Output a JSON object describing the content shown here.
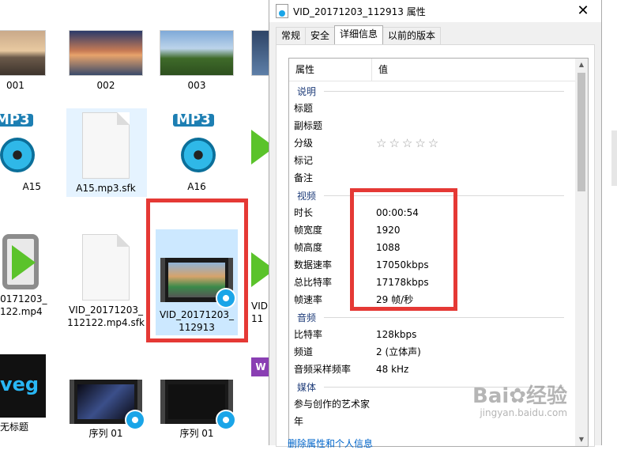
{
  "explorer": {
    "files": [
      {
        "label": "001",
        "icon": "photo-thumbnail"
      },
      {
        "label": "002",
        "icon": "photo-thumbnail"
      },
      {
        "label": "003",
        "icon": "photo-thumbnail"
      },
      {
        "label": "A15",
        "icon": "mp3-file-icon"
      },
      {
        "label": "A15.mp3.sfk",
        "icon": "blank-file-icon"
      },
      {
        "label": "A16",
        "icon": "mp3-file-icon"
      },
      {
        "label": "_20171203_\n2122.mp4",
        "icon": "video-player-icon"
      },
      {
        "label": "VID_20171203_\n112122.mp4.sfk",
        "icon": "blank-file-icon"
      },
      {
        "label": "VID_20171203_\n112913",
        "icon": "video-thumbnail"
      },
      {
        "label": "VID\n11",
        "icon": "video-player-icon"
      },
      {
        "label": "无标题",
        "icon": "vegas-project-icon"
      },
      {
        "label": "序列 01",
        "icon": "video-thumbnail"
      },
      {
        "label": "序列 01",
        "icon": "video-thumbnail"
      }
    ]
  },
  "dialog": {
    "title": "VID_20171203_112913 属性",
    "close_glyph": "✕",
    "tabs": [
      "常规",
      "安全",
      "详细信息",
      "以前的版本"
    ],
    "columns": {
      "property": "属性",
      "value": "值"
    },
    "sections": {
      "description": {
        "title": "说明",
        "rows": [
          {
            "k": "标题",
            "v": ""
          },
          {
            "k": "副标题",
            "v": ""
          },
          {
            "k": "分级",
            "v": "☆☆☆☆☆"
          },
          {
            "k": "标记",
            "v": ""
          },
          {
            "k": "备注",
            "v": ""
          }
        ]
      },
      "video": {
        "title": "视频",
        "rows": [
          {
            "k": "时长",
            "v": "00:00:54"
          },
          {
            "k": "帧宽度",
            "v": "1920"
          },
          {
            "k": "帧高度",
            "v": "1088"
          },
          {
            "k": "数据速率",
            "v": "17050kbps"
          },
          {
            "k": "总比特率",
            "v": "17178kbps"
          },
          {
            "k": "帧速率",
            "v": "29 帧/秒"
          }
        ]
      },
      "audio": {
        "title": "音频",
        "rows": [
          {
            "k": "比特率",
            "v": "128kbps"
          },
          {
            "k": "频道",
            "v": "2 (立体声)"
          },
          {
            "k": "音频采样频率",
            "v": "48 kHz"
          }
        ]
      },
      "media": {
        "title": "媒体",
        "rows": [
          {
            "k": "参与创作的艺术家",
            "v": ""
          },
          {
            "k": "年",
            "v": ""
          }
        ]
      }
    },
    "footer_link": "删除属性和个人信息"
  },
  "watermark": {
    "text": "Bai✿经验",
    "sub": "jingyan.baidu.com"
  },
  "colors": {
    "highlight": "#e53935",
    "selection": "#cce8ff",
    "section_title": "#1f3d7a",
    "link": "#0066cc"
  }
}
